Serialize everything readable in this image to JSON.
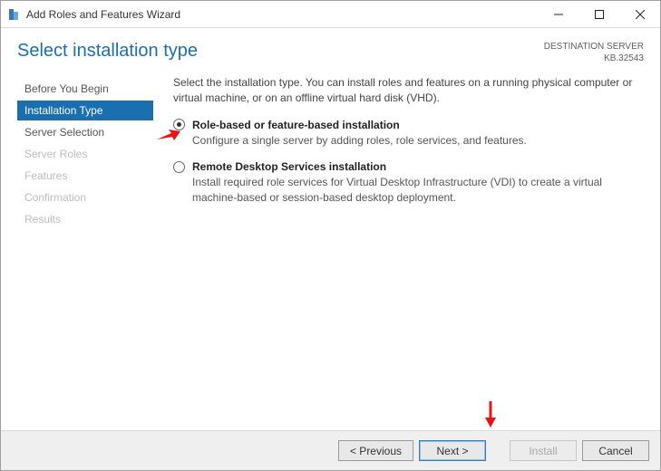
{
  "window_title": "Add Roles and Features Wizard",
  "page_title": "Select installation type",
  "destination": {
    "label": "DESTINATION SERVER",
    "name": "KB.32543"
  },
  "sidebar": {
    "items": [
      {
        "label": "Before You Begin",
        "state": "normal"
      },
      {
        "label": "Installation Type",
        "state": "active"
      },
      {
        "label": "Server Selection",
        "state": "normal"
      },
      {
        "label": "Server Roles",
        "state": "disabled"
      },
      {
        "label": "Features",
        "state": "disabled"
      },
      {
        "label": "Confirmation",
        "state": "disabled"
      },
      {
        "label": "Results",
        "state": "disabled"
      }
    ]
  },
  "intro_text": "Select the installation type. You can install roles and features on a running physical computer or virtual machine, or on an offline virtual hard disk (VHD).",
  "options": [
    {
      "label": "Role-based or feature-based installation",
      "desc": "Configure a single server by adding roles, role services, and features.",
      "selected": true
    },
    {
      "label": "Remote Desktop Services installation",
      "desc": "Install required role services for Virtual Desktop Infrastructure (VDI) to create a virtual machine-based or session-based desktop deployment.",
      "selected": false
    }
  ],
  "buttons": {
    "previous": "< Previous",
    "next": "Next >",
    "install": "Install",
    "cancel": "Cancel"
  }
}
